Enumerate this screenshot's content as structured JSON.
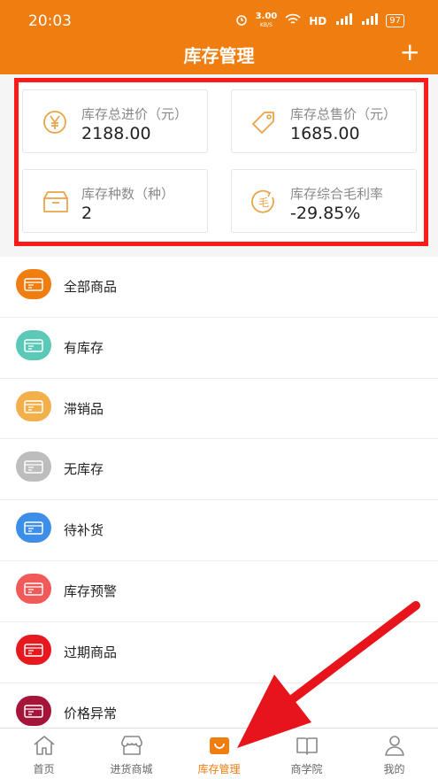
{
  "status_bar": {
    "time": "20:03",
    "speed": "3.00",
    "speed_unit": "KB/S",
    "network": "HD",
    "battery": "97"
  },
  "header": {
    "title": "库存管理",
    "add_label": "+"
  },
  "summary": [
    {
      "label": "库存总进价（元）",
      "value": "2188.00",
      "icon": "yen-coin-icon"
    },
    {
      "label": "库存总售价（元）",
      "value": "1685.00",
      "icon": "price-tag-icon"
    },
    {
      "label": "库存种数（种）",
      "value": "2",
      "icon": "box-icon"
    },
    {
      "label": "库存综合毛利率",
      "value": "-29.85%",
      "icon": "gross-margin-icon"
    }
  ],
  "menu": [
    {
      "label": "全部商品",
      "color": "#f07d10"
    },
    {
      "label": "有库存",
      "color": "#5bc8b8"
    },
    {
      "label": "滞销品",
      "color": "#f3b04a"
    },
    {
      "label": "无库存",
      "color": "#bdbdbd"
    },
    {
      "label": "待补货",
      "color": "#3d8ee8"
    },
    {
      "label": "库存预警",
      "color": "#f25a5a"
    },
    {
      "label": "过期商品",
      "color": "#e8181f"
    },
    {
      "label": "价格异常",
      "color": "#a5153a"
    }
  ],
  "tabs": [
    {
      "label": "首页",
      "icon": "home-icon"
    },
    {
      "label": "进货商城",
      "icon": "store-icon"
    },
    {
      "label": "库存管理",
      "icon": "inventory-bag-icon",
      "active": true
    },
    {
      "label": "商学院",
      "icon": "book-icon"
    },
    {
      "label": "我的",
      "icon": "user-icon"
    }
  ],
  "colors": {
    "brand": "#f07d10",
    "highlight": "#ff1a1a",
    "arrow": "#e8141c"
  }
}
